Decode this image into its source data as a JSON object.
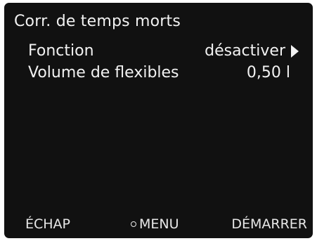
{
  "screen": {
    "title": "Corr. de temps morts",
    "rows": [
      {
        "label": "Fonction",
        "value": "désactiver"
      },
      {
        "label": "Volume de flexibles",
        "value": "0,50 l"
      }
    ]
  },
  "softkeys": {
    "escape": "ÉCHAP",
    "menu": "MENU",
    "start": "DÉMARRER"
  },
  "icons": {
    "row_arrow": "triangle-right-icon",
    "menu_dot": "circle-icon"
  },
  "colors": {
    "background": "#111111",
    "text": "#f2f2f2"
  }
}
